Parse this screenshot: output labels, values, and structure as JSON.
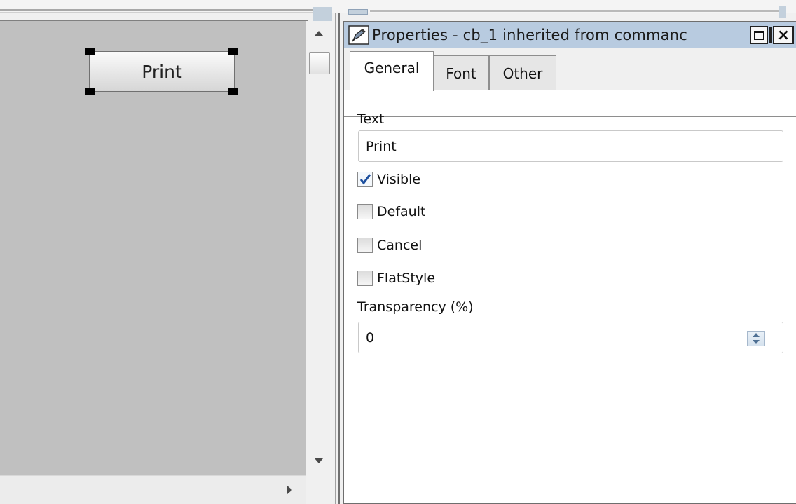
{
  "canvas": {
    "button_label": "Print"
  },
  "properties": {
    "title": "Properties - cb_1 inherited from commanc",
    "close_glyph": "×",
    "tabs": [
      {
        "label": "General",
        "active": true
      },
      {
        "label": "Font",
        "active": false
      },
      {
        "label": "Other",
        "active": false
      }
    ],
    "text_label": "Text",
    "text_value": "Print",
    "checkboxes": [
      {
        "label": "Visible",
        "checked": true
      },
      {
        "label": "Default",
        "checked": false
      },
      {
        "label": "Cancel",
        "checked": false
      },
      {
        "label": "FlatStyle",
        "checked": false
      }
    ],
    "transparency_label": "Transparency (%)",
    "transparency_value": "0"
  },
  "icons": {
    "title_icon": "properties-icon",
    "maximize": "maximize-icon",
    "close": "close-icon",
    "scroll_up": "arrow-up-icon",
    "scroll_down": "arrow-down-icon",
    "scroll_right": "arrow-right-icon",
    "spin": "spin-updown-icon",
    "check": "checkmark-icon"
  },
  "colors": {
    "canvas_bg": "#c0c0c0",
    "title_bar": "#b8cbe0",
    "check_blue": "#1d4f9e"
  }
}
